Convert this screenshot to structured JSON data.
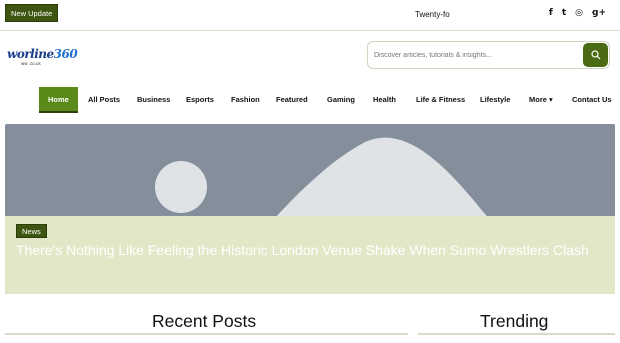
{
  "topbar": {
    "update_label": "New Update",
    "ticker_text": "Twenty-fo",
    "social": [
      {
        "icon": "facebook-icon",
        "glyph": "f"
      },
      {
        "icon": "twitter-icon",
        "glyph": "t"
      },
      {
        "icon": "instagram-icon",
        "glyph": "◎"
      },
      {
        "icon": "google-plus-icon",
        "glyph": "g+"
      }
    ]
  },
  "logo": {
    "text_main": "worline",
    "text_num": "360",
    "text_sub": "ww     .co.uk"
  },
  "search": {
    "placeholder": "Discover articles, tutorials & insights..."
  },
  "nav": {
    "items": [
      {
        "label": "Home",
        "active": true
      },
      {
        "label": "All Posts"
      },
      {
        "label": "Business"
      },
      {
        "label": "Esports"
      },
      {
        "label": "Fashion"
      },
      {
        "label": "Featured"
      },
      {
        "label": "Gaming"
      },
      {
        "label": "Health"
      },
      {
        "label": "Life & Fitness"
      },
      {
        "label": "Lifestyle"
      },
      {
        "label": "More ▾"
      },
      {
        "label": "Contact Us"
      }
    ]
  },
  "hero": {
    "badge": "News",
    "headline": "There's Nothing Like Feeling the Historic London Venue Shake When Sumo Wrestlers Clash"
  },
  "sections": {
    "recent": "Recent Posts",
    "trending": "Trending"
  },
  "colors": {
    "accent": "#5c8a1a",
    "dark_green": "#3d5511",
    "hero_bg": "#858f9b"
  }
}
